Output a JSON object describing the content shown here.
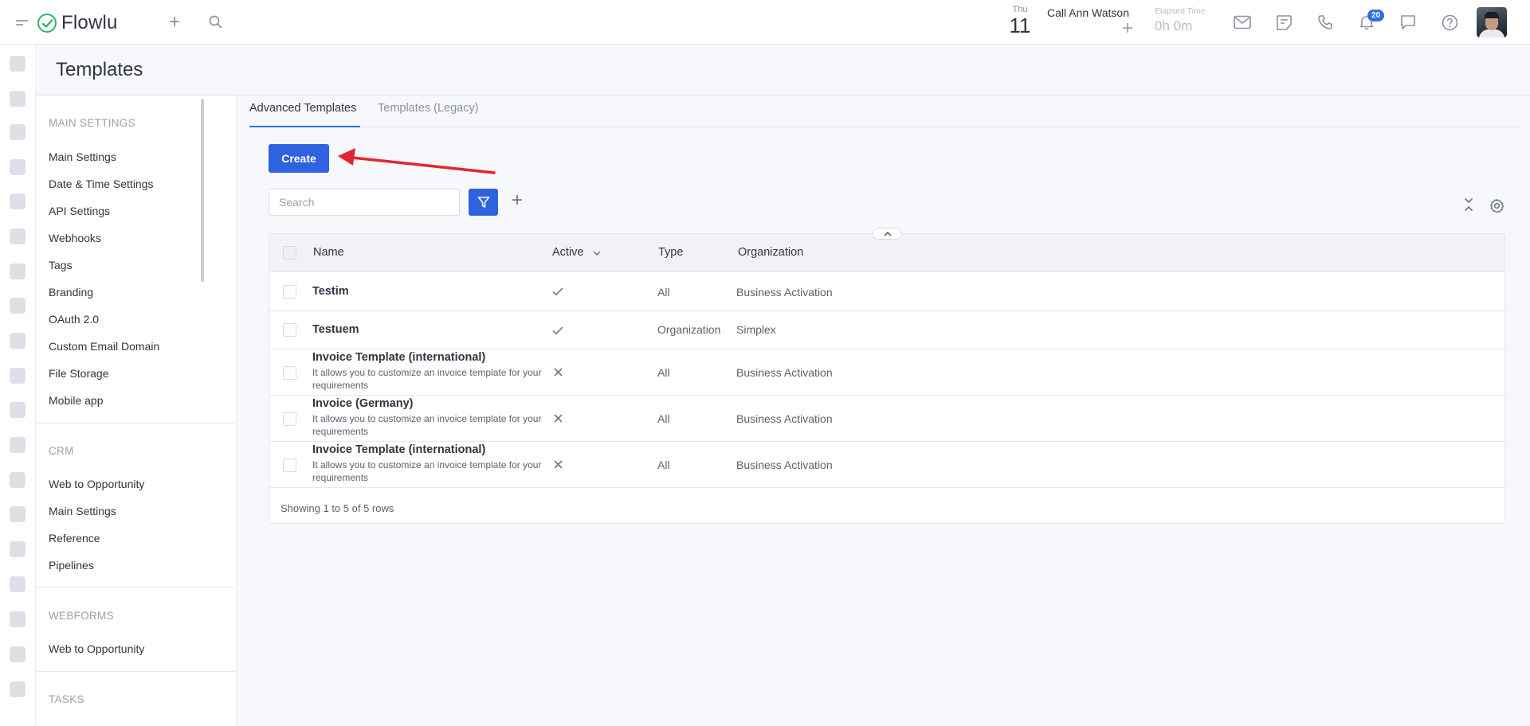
{
  "app": {
    "name": "Flowlu"
  },
  "topbar": {
    "date": {
      "dow": "Thu",
      "day": "11"
    },
    "call": {
      "title": "Call Ann Watson"
    },
    "timer": {
      "label": "Elapsed Time",
      "value": "0h 0m"
    },
    "notifications_count": "20",
    "icons": [
      "mail-icon",
      "notes-icon",
      "phone-icon",
      "bell-icon",
      "chat-icon",
      "help-icon"
    ]
  },
  "page": {
    "title": "Templates"
  },
  "sidebar": {
    "sections": [
      {
        "title": "MAIN SETTINGS",
        "items": [
          "Main Settings",
          "Date & Time Settings",
          "API Settings",
          "Webhooks",
          "Tags",
          "Branding",
          "OAuth 2.0",
          "Custom Email Domain",
          "File Storage",
          "Mobile app"
        ]
      },
      {
        "title": "CRM",
        "items": [
          "Web to Opportunity",
          "Main Settings",
          "Reference",
          "Pipelines"
        ]
      },
      {
        "title": "WEBFORMS",
        "items": [
          "Web to Opportunity"
        ]
      },
      {
        "title": "TASKS",
        "items": []
      }
    ]
  },
  "tabs": [
    {
      "label": "Advanced Templates",
      "active": true
    },
    {
      "label": "Templates (Legacy)",
      "active": false
    }
  ],
  "toolbar": {
    "create_label": "Create",
    "search_placeholder": "Search"
  },
  "table": {
    "columns": [
      "Name",
      "Active",
      "Type",
      "Organization"
    ],
    "rows": [
      {
        "name": "Testim",
        "description": "",
        "active": true,
        "type": "All",
        "organization": "Business Activation"
      },
      {
        "name": "Testuem",
        "description": "",
        "active": true,
        "type": "Organization",
        "organization": "Simplex"
      },
      {
        "name": "Invoice Template (international)",
        "description": "It allows you to customize an invoice template for your requirements",
        "active": false,
        "type": "All",
        "organization": "Business Activation"
      },
      {
        "name": "Invoice (Germany)",
        "description": "It allows you to customize an invoice template for your requirements",
        "active": false,
        "type": "All",
        "organization": "Business Activation"
      },
      {
        "name": "Invoice Template (international)",
        "description": "It allows you to customize an invoice template for your requirements",
        "active": false,
        "type": "All",
        "organization": "Business Activation"
      }
    ],
    "footer": "Showing 1 to 5 of 5 rows"
  },
  "colors": {
    "accent": "#2f62e0",
    "brand": "#2cb36b",
    "annotation": "#e3262b"
  }
}
